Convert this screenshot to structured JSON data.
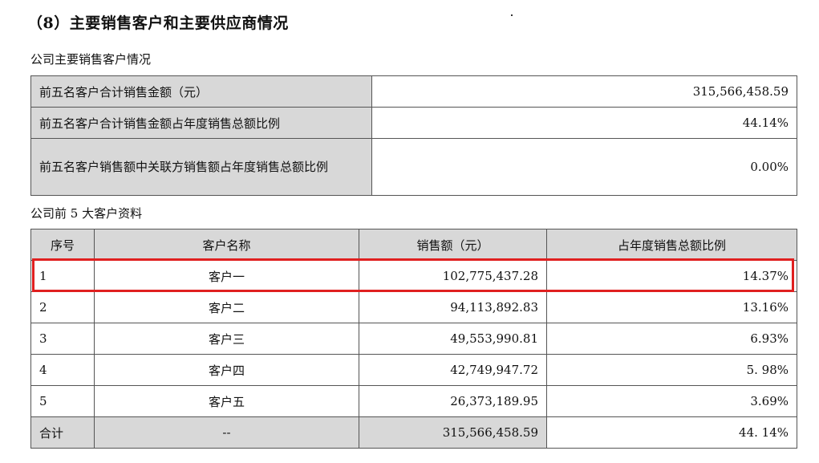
{
  "heading": "（8）主要销售客户和主要供应商情况",
  "summary_caption": "公司主要销售客户情况",
  "summary_rows": [
    {
      "label": "前五名客户合计销售金额（元）",
      "value": "315,566,458.59"
    },
    {
      "label": "前五名客户合计销售金额占年度销售总额比例",
      "value": "44.14%"
    },
    {
      "label": "前五名客户销售额中关联方销售额占年度销售总额比例",
      "value": "0.00%"
    }
  ],
  "detail_caption": "公司前 5 大客户资料",
  "detail_headers": [
    "序号",
    "客户名称",
    "销售额（元）",
    "占年度销售总额比例"
  ],
  "detail_rows": [
    [
      "1",
      "客户一",
      "102,775,437.28",
      "14.37%"
    ],
    [
      "2",
      "客户二",
      "94,113,892.83",
      "13.16%"
    ],
    [
      "3",
      "客户三",
      "49,553,990.81",
      "6.93%"
    ],
    [
      "4",
      "客户四",
      "42,749,947.72",
      "5. 98%"
    ],
    [
      "5",
      "客户五",
      "26,373,189.95",
      "3.69%"
    ]
  ],
  "total_row": [
    "合计",
    "--",
    "315,566,458.59",
    "44. 14%"
  ],
  "colors": {
    "highlight": "#e02020",
    "label_bg": "#d8d8d8"
  }
}
